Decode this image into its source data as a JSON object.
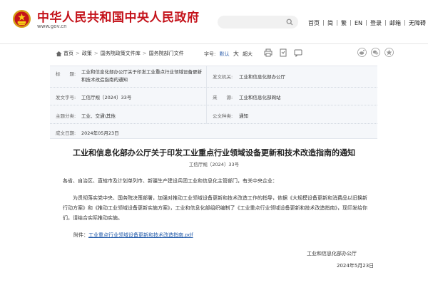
{
  "header": {
    "site_name": "中华人民共和国中央人民政府",
    "site_url": "www.gov.cn",
    "nav": [
      "首页",
      "简",
      "繁",
      "EN",
      "登录",
      "邮箱",
      "无障碍"
    ]
  },
  "breadcrumb": {
    "items": [
      "首页",
      "政策",
      "国务院政策文件库",
      "国务院部门文件"
    ],
    "separator": ">"
  },
  "font_size": {
    "label": "字号:",
    "options": [
      "默认",
      "大",
      "超大"
    ],
    "active": "默认"
  },
  "meta": {
    "title_label": "标　　题:",
    "title_value": "工业和信息化部办公厅关于印发工业重点行业领域设备更新和技术改造指南的通知",
    "issuer_label": "发文机关:",
    "issuer_value": "工业和信息化部办公厅",
    "docno_label": "发文字号:",
    "docno_value": "工信厅规〔2024〕33号",
    "source_label": "来　　源:",
    "source_value": "工业和信息化部网站",
    "category_label": "主题分类:",
    "category_value": "工业、交通\\其他",
    "type_label": "公文种类:",
    "type_value": "通知",
    "date_label": "成文日期:",
    "date_value": "2024年05月23日"
  },
  "article": {
    "title": "工业和信息化部办公厅关于印发工业重点行业领域设备更新和技术改造指南的通知",
    "docno": "工信厅规〔2024〕33号",
    "addressee": "各省、自治区、直辖市及计划单列市、新疆生产建设兵团工业和信息化主管部门，有关中央企业：",
    "body": "为贯彻落实党中央、国务院决策部署，加强对推动工业领域设备更新和技术改造工作的指导，依据《大规模设备更新和消费品以旧换新行动方案》和《推动工业领域设备更新实施方案》，工业和信息化部组织编制了《工业重点行业领域设备更新和技术改造指南》，现印发给你们，请结合实际推动实施。",
    "attachment_label": "附件：",
    "attachment_link": "工业重点行业领域设备更新和技术改造指南.pdf",
    "signer": "工业和信息化部办公厅",
    "date": "2024年5月23日"
  },
  "colors": {
    "brand_red": "#c4121a",
    "link_blue": "#1d57a8",
    "meta_bg": "#f5f7fa"
  },
  "icons": [
    "national-emblem-icon",
    "search-icon",
    "home-icon",
    "print-icon",
    "collect-icon",
    "message-icon",
    "wechat-icon",
    "weibo-icon",
    "qzone-icon"
  ]
}
